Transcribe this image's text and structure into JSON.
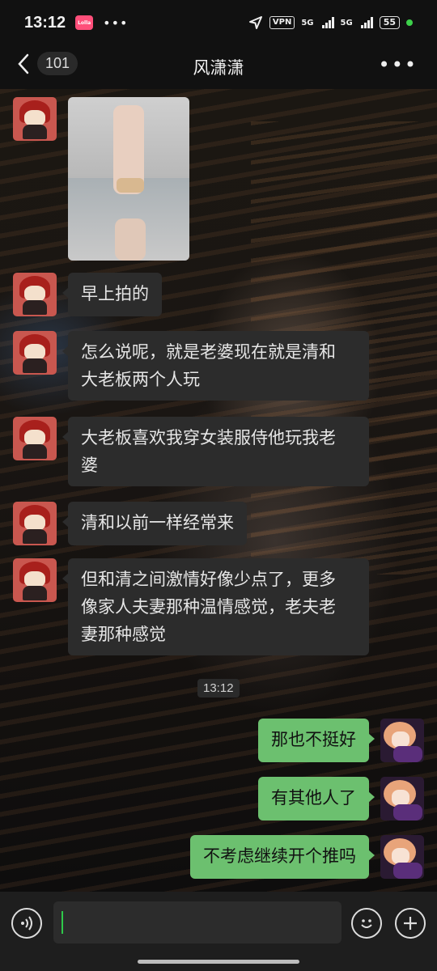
{
  "status_bar": {
    "time": "13:12",
    "app_badge": "Lolla",
    "more": "•••",
    "vpn": "VPN",
    "network1": "5G",
    "network2": "5G",
    "battery": "55"
  },
  "header": {
    "back_count": "101",
    "title": "风潇潇",
    "more": "•••"
  },
  "messages": [
    {
      "from": "them",
      "type": "image",
      "content": "photo"
    },
    {
      "from": "them",
      "type": "text",
      "content": "早上拍的"
    },
    {
      "from": "them",
      "type": "text",
      "content": "怎么说呢，就是老婆现在就是清和\n大老板两个人玩"
    },
    {
      "from": "them",
      "type": "text",
      "content": "大老板喜欢我穿女装服侍他玩我老\n婆"
    },
    {
      "from": "them",
      "type": "text",
      "content": "清和以前一样经常来"
    },
    {
      "from": "them",
      "type": "text",
      "content": "但和清之间激情好像少点了，更多\n像家人夫妻那种温情感觉，老夫老\n妻那种感觉"
    },
    {
      "from": "me",
      "type": "text",
      "content": "那也不挺好"
    },
    {
      "from": "me",
      "type": "text",
      "content": "有其他人了"
    },
    {
      "from": "me",
      "type": "text",
      "content": "不考虑继续开个推吗"
    }
  ],
  "timestamp": "13:12",
  "input": {
    "value": ""
  }
}
